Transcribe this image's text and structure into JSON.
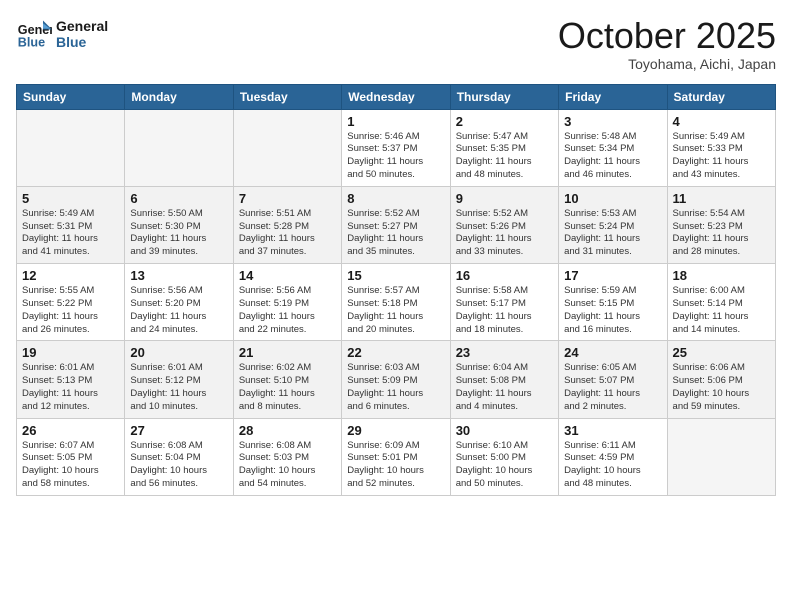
{
  "header": {
    "logo_line1": "General",
    "logo_line2": "Blue",
    "month": "October 2025",
    "location": "Toyohama, Aichi, Japan"
  },
  "weekdays": [
    "Sunday",
    "Monday",
    "Tuesday",
    "Wednesday",
    "Thursday",
    "Friday",
    "Saturday"
  ],
  "weeks": [
    [
      {
        "day": "",
        "info": ""
      },
      {
        "day": "",
        "info": ""
      },
      {
        "day": "",
        "info": ""
      },
      {
        "day": "1",
        "info": "Sunrise: 5:46 AM\nSunset: 5:37 PM\nDaylight: 11 hours\nand 50 minutes."
      },
      {
        "day": "2",
        "info": "Sunrise: 5:47 AM\nSunset: 5:35 PM\nDaylight: 11 hours\nand 48 minutes."
      },
      {
        "day": "3",
        "info": "Sunrise: 5:48 AM\nSunset: 5:34 PM\nDaylight: 11 hours\nand 46 minutes."
      },
      {
        "day": "4",
        "info": "Sunrise: 5:49 AM\nSunset: 5:33 PM\nDaylight: 11 hours\nand 43 minutes."
      }
    ],
    [
      {
        "day": "5",
        "info": "Sunrise: 5:49 AM\nSunset: 5:31 PM\nDaylight: 11 hours\nand 41 minutes."
      },
      {
        "day": "6",
        "info": "Sunrise: 5:50 AM\nSunset: 5:30 PM\nDaylight: 11 hours\nand 39 minutes."
      },
      {
        "day": "7",
        "info": "Sunrise: 5:51 AM\nSunset: 5:28 PM\nDaylight: 11 hours\nand 37 minutes."
      },
      {
        "day": "8",
        "info": "Sunrise: 5:52 AM\nSunset: 5:27 PM\nDaylight: 11 hours\nand 35 minutes."
      },
      {
        "day": "9",
        "info": "Sunrise: 5:52 AM\nSunset: 5:26 PM\nDaylight: 11 hours\nand 33 minutes."
      },
      {
        "day": "10",
        "info": "Sunrise: 5:53 AM\nSunset: 5:24 PM\nDaylight: 11 hours\nand 31 minutes."
      },
      {
        "day": "11",
        "info": "Sunrise: 5:54 AM\nSunset: 5:23 PM\nDaylight: 11 hours\nand 28 minutes."
      }
    ],
    [
      {
        "day": "12",
        "info": "Sunrise: 5:55 AM\nSunset: 5:22 PM\nDaylight: 11 hours\nand 26 minutes."
      },
      {
        "day": "13",
        "info": "Sunrise: 5:56 AM\nSunset: 5:20 PM\nDaylight: 11 hours\nand 24 minutes."
      },
      {
        "day": "14",
        "info": "Sunrise: 5:56 AM\nSunset: 5:19 PM\nDaylight: 11 hours\nand 22 minutes."
      },
      {
        "day": "15",
        "info": "Sunrise: 5:57 AM\nSunset: 5:18 PM\nDaylight: 11 hours\nand 20 minutes."
      },
      {
        "day": "16",
        "info": "Sunrise: 5:58 AM\nSunset: 5:17 PM\nDaylight: 11 hours\nand 18 minutes."
      },
      {
        "day": "17",
        "info": "Sunrise: 5:59 AM\nSunset: 5:15 PM\nDaylight: 11 hours\nand 16 minutes."
      },
      {
        "day": "18",
        "info": "Sunrise: 6:00 AM\nSunset: 5:14 PM\nDaylight: 11 hours\nand 14 minutes."
      }
    ],
    [
      {
        "day": "19",
        "info": "Sunrise: 6:01 AM\nSunset: 5:13 PM\nDaylight: 11 hours\nand 12 minutes."
      },
      {
        "day": "20",
        "info": "Sunrise: 6:01 AM\nSunset: 5:12 PM\nDaylight: 11 hours\nand 10 minutes."
      },
      {
        "day": "21",
        "info": "Sunrise: 6:02 AM\nSunset: 5:10 PM\nDaylight: 11 hours\nand 8 minutes."
      },
      {
        "day": "22",
        "info": "Sunrise: 6:03 AM\nSunset: 5:09 PM\nDaylight: 11 hours\nand 6 minutes."
      },
      {
        "day": "23",
        "info": "Sunrise: 6:04 AM\nSunset: 5:08 PM\nDaylight: 11 hours\nand 4 minutes."
      },
      {
        "day": "24",
        "info": "Sunrise: 6:05 AM\nSunset: 5:07 PM\nDaylight: 11 hours\nand 2 minutes."
      },
      {
        "day": "25",
        "info": "Sunrise: 6:06 AM\nSunset: 5:06 PM\nDaylight: 10 hours\nand 59 minutes."
      }
    ],
    [
      {
        "day": "26",
        "info": "Sunrise: 6:07 AM\nSunset: 5:05 PM\nDaylight: 10 hours\nand 58 minutes."
      },
      {
        "day": "27",
        "info": "Sunrise: 6:08 AM\nSunset: 5:04 PM\nDaylight: 10 hours\nand 56 minutes."
      },
      {
        "day": "28",
        "info": "Sunrise: 6:08 AM\nSunset: 5:03 PM\nDaylight: 10 hours\nand 54 minutes."
      },
      {
        "day": "29",
        "info": "Sunrise: 6:09 AM\nSunset: 5:01 PM\nDaylight: 10 hours\nand 52 minutes."
      },
      {
        "day": "30",
        "info": "Sunrise: 6:10 AM\nSunset: 5:00 PM\nDaylight: 10 hours\nand 50 minutes."
      },
      {
        "day": "31",
        "info": "Sunrise: 6:11 AM\nSunset: 4:59 PM\nDaylight: 10 hours\nand 48 minutes."
      },
      {
        "day": "",
        "info": ""
      }
    ]
  ]
}
